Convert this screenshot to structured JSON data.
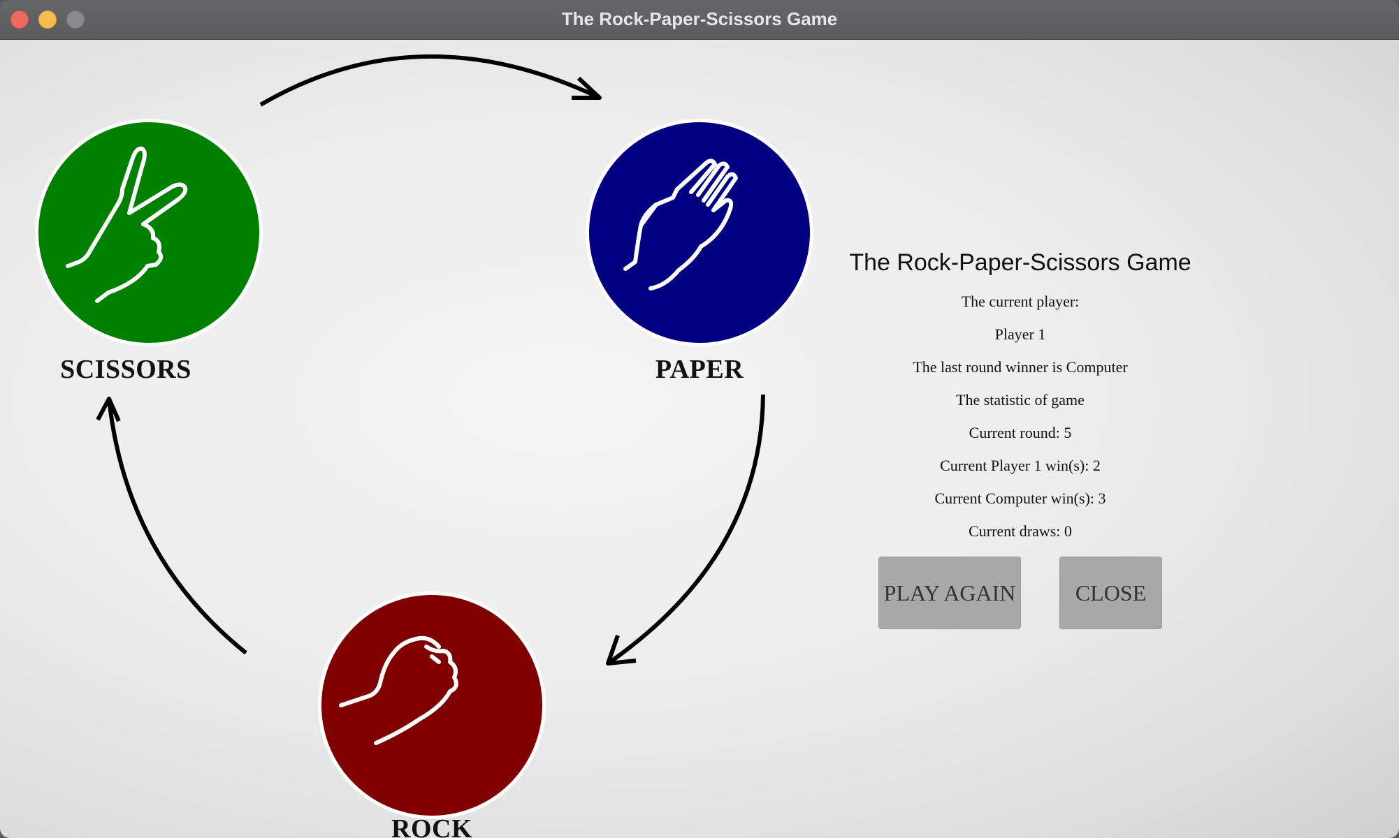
{
  "window": {
    "title": "The Rock-Paper-Scissors Game"
  },
  "choices": {
    "scissors": {
      "label": "SCISSORS",
      "color": "#008000"
    },
    "paper": {
      "label": "PAPER",
      "color": "#000080"
    },
    "rock": {
      "label": "ROCK",
      "color": "#800000"
    }
  },
  "panel": {
    "title": "The Rock-Paper-Scissors Game",
    "current_player_label": "The current player:",
    "current_player": "Player 1",
    "last_winner": "The last round winner is Computer",
    "statistic_heading": "The statistic of game",
    "current_round": "Current round: 5",
    "player_wins": "Current Player 1 win(s): 2",
    "computer_wins": "Current Computer win(s): 3",
    "draws": "Current draws: 0"
  },
  "buttons": {
    "play_again": "PLAY AGAIN",
    "close": "CLOSE"
  }
}
